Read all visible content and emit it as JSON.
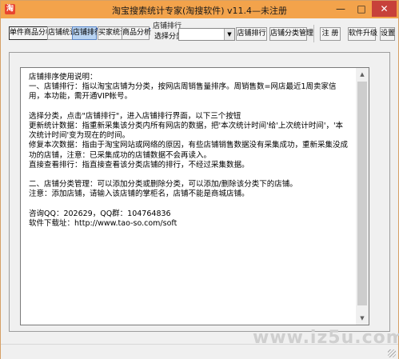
{
  "window": {
    "title": "淘宝搜索统计专家(淘搜软件) v11.4—未注册",
    "app_icon": "淘",
    "minimize_icon": "—",
    "maximize_icon": "□",
    "close_icon": "✕"
  },
  "toolbar": {
    "single_analysis": "单件商品分析",
    "shop_stats": "店铺统计",
    "shop_rank": "店铺排行",
    "seller_stats": "买家统计",
    "product_analysis": "商品分析",
    "group_label": "店铺排行",
    "select_label": "选择分类",
    "select_value": "",
    "select_arrow": "▼",
    "rank_button": "店铺排行",
    "category_manage": "店铺分类管理",
    "register": "注 册",
    "upgrade": "软件升级",
    "settings": "设置"
  },
  "content": {
    "text": "店铺排序使用说明：\n一、店铺排行：指以淘宝店铺为分类，按网店周销售量排序。周销售数=网店最近1周卖家信用，本功能，需开通VIP帐号。\n\n选择分类，点击\"店铺排行\"，进入店铺排行界面，以下三个按钮\n更新统计数据：指重新采集该分类内所有网店的数据，把'本次统计时间'给'上次统计时间'，'本次统计时间'变为现在的时间。\n修复本次数据：指由于淘宝网站或网络的原因，有些店铺销售数据没有采集成功，重新采集没成功的店铺，注意：已采集成功的店铺数据不会再读入。\n直接查看排行：指直接查看该分类店铺的排行，不经过采集数据。\n\n二、店铺分类管理：可以添加分类或删除分类，可以添加/删除该分类下的店铺。\n注意：添加店铺，请输入该店铺的掌柜名，店铺不能是商城店铺。\n\n咨询QQ：202629，QQ群：104764836\n软件下载址：http://www.tao-so.com/soft"
  },
  "scrollbar": {
    "up_icon": "▲",
    "down_icon": "▼"
  },
  "watermark": {
    "text": "www.iz5u.com"
  },
  "colors": {
    "titlebar": "#f3a34b",
    "close": "#c7413a",
    "active_button": "#b9d4f3",
    "accent_line": "#3c6ddb"
  }
}
